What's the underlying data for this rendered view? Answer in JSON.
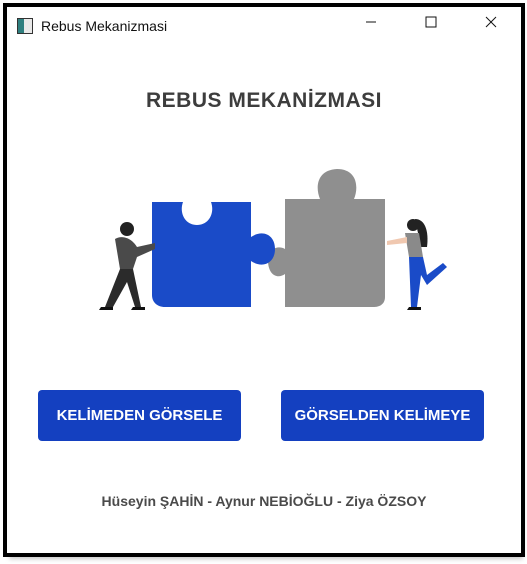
{
  "window": {
    "title": "Rebus Mekanizmasi"
  },
  "header": {
    "title": "REBUS MEKANİZMASI"
  },
  "buttons": {
    "word_to_image": "KELİMEDEN GÖRSELE",
    "image_to_word": "GÖRSELDEN KELİMEYE"
  },
  "footer": {
    "authors": "Hüseyin ŞAHİN - Aynur NEBİOĞLU - Ziya ÖZSOY"
  },
  "colors": {
    "accent": "#1440c0",
    "puzzle_blue": "#1a4bc8",
    "puzzle_gray": "#8f8f8f",
    "heading": "#3d3d3d"
  }
}
